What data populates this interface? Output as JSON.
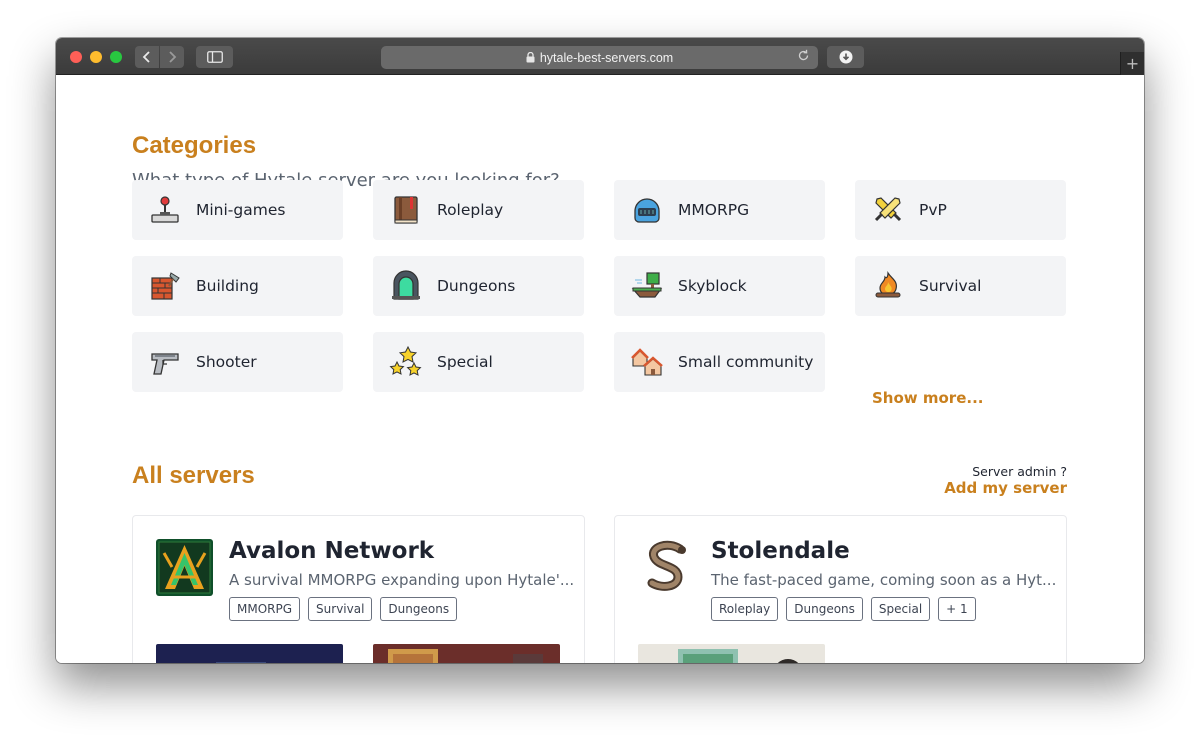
{
  "browser": {
    "url": "hytale-best-servers.com"
  },
  "categories": {
    "title": "Categories",
    "subtitle": "What type of Hytale server are you looking for?",
    "items": [
      {
        "label": "Mini-games",
        "icon": "joystick-icon"
      },
      {
        "label": "Roleplay",
        "icon": "book-icon"
      },
      {
        "label": "MMORPG",
        "icon": "helmet-icon"
      },
      {
        "label": "PvP",
        "icon": "crossed-swords-icon"
      },
      {
        "label": "Building",
        "icon": "brick-wall-icon"
      },
      {
        "label": "Dungeons",
        "icon": "dungeon-door-icon"
      },
      {
        "label": "Skyblock",
        "icon": "floating-island-icon"
      },
      {
        "label": "Survival",
        "icon": "campfire-icon"
      },
      {
        "label": "Shooter",
        "icon": "pistol-icon"
      },
      {
        "label": "Special",
        "icon": "stars-icon"
      },
      {
        "label": "Small community",
        "icon": "houses-icon"
      }
    ],
    "show_more": "Show more..."
  },
  "servers_section": {
    "title": "All servers",
    "admin_question": "Server admin ?",
    "add_server": "Add my server"
  },
  "servers": [
    {
      "name": "Avalon Network",
      "description": "A survival MMORPG expanding upon Hytale'...",
      "tags": [
        "MMORPG",
        "Survival",
        "Dungeons"
      ],
      "logo": "avalon-logo-icon"
    },
    {
      "name": "Stolendale",
      "description": "The fast-paced game, coming soon as a Hyt...",
      "tags": [
        "Roleplay",
        "Dungeons",
        "Special",
        "+ 1"
      ],
      "logo": "snake-logo-icon"
    }
  ],
  "colors": {
    "accent": "#c9801e",
    "card_bg": "#f3f4f6",
    "text_dark": "#1f2430",
    "text_muted": "#5b6470"
  }
}
